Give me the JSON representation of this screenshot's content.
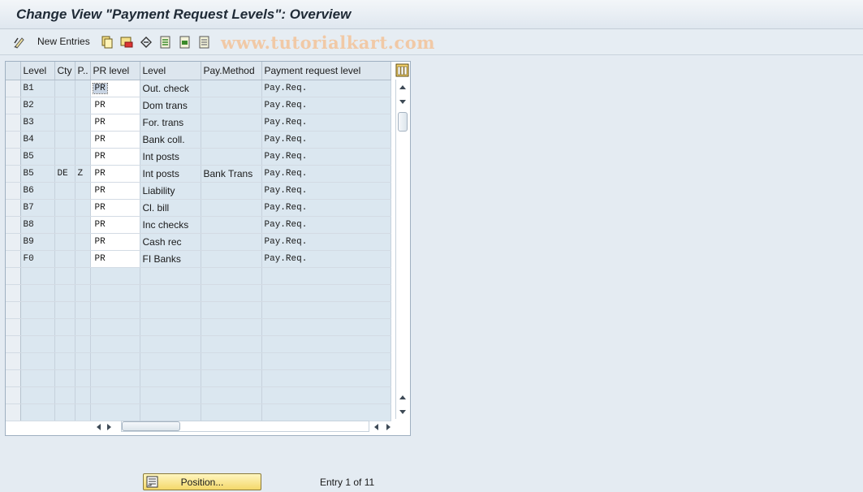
{
  "window": {
    "title": "Change View \"Payment Request Levels\": Overview"
  },
  "toolbar": {
    "new_entries_label": "New Entries",
    "watermark": "www.tutorialkart.com",
    "icons": [
      "display-change-icon",
      "copy-icon",
      "delete-icon",
      "undo-icon",
      "select-all-icon",
      "select-block-icon",
      "deselect-all-icon"
    ]
  },
  "table": {
    "columns": [
      "Level",
      "Cty",
      "P..",
      "PR level",
      "Level",
      "Pay.Method",
      "Payment request level"
    ],
    "rows": [
      {
        "level": "B1",
        "cty": "",
        "p": "",
        "pr_level": "PR",
        "level_text": "Out. check",
        "pay_method": "",
        "payment_request_level": "Pay.Req."
      },
      {
        "level": "B2",
        "cty": "",
        "p": "",
        "pr_level": "PR",
        "level_text": "Dom trans",
        "pay_method": "",
        "payment_request_level": "Pay.Req."
      },
      {
        "level": "B3",
        "cty": "",
        "p": "",
        "pr_level": "PR",
        "level_text": "For. trans",
        "pay_method": "",
        "payment_request_level": "Pay.Req."
      },
      {
        "level": "B4",
        "cty": "",
        "p": "",
        "pr_level": "PR",
        "level_text": "Bank coll.",
        "pay_method": "",
        "payment_request_level": "Pay.Req."
      },
      {
        "level": "B5",
        "cty": "",
        "p": "",
        "pr_level": "PR",
        "level_text": "Int posts",
        "pay_method": "",
        "payment_request_level": "Pay.Req."
      },
      {
        "level": "B5",
        "cty": "DE",
        "p": "Z",
        "pr_level": "PR",
        "level_text": "Int posts",
        "pay_method": "Bank Trans",
        "payment_request_level": "Pay.Req."
      },
      {
        "level": "B6",
        "cty": "",
        "p": "",
        "pr_level": "PR",
        "level_text": "Liability",
        "pay_method": "",
        "payment_request_level": "Pay.Req."
      },
      {
        "level": "B7",
        "cty": "",
        "p": "",
        "pr_level": "PR",
        "level_text": "Cl. bill",
        "pay_method": "",
        "payment_request_level": "Pay.Req."
      },
      {
        "level": "B8",
        "cty": "",
        "p": "",
        "pr_level": "PR",
        "level_text": "Inc checks",
        "pay_method": "",
        "payment_request_level": "Pay.Req."
      },
      {
        "level": "B9",
        "cty": "",
        "p": "",
        "pr_level": "PR",
        "level_text": "Cash rec",
        "pay_method": "",
        "payment_request_level": "Pay.Req."
      },
      {
        "level": "F0",
        "cty": "",
        "p": "",
        "pr_level": "PR",
        "level_text": "FI Banks",
        "pay_method": "",
        "payment_request_level": "Pay.Req."
      }
    ],
    "empty_row_count": 9,
    "focused_row": 0
  },
  "footer": {
    "position_label": "Position...",
    "entry_info": "Entry 1 of 11"
  }
}
